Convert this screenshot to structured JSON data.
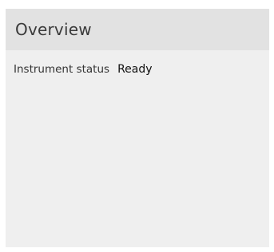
{
  "overview": {
    "title": "Overview",
    "status_label": "Instrument status",
    "status_value": "Ready"
  },
  "colors": {
    "header_bg": "#e2e2e2",
    "panel_bg": "#efefef",
    "title_text": "#3a3a3a",
    "value_text": "#111111"
  }
}
